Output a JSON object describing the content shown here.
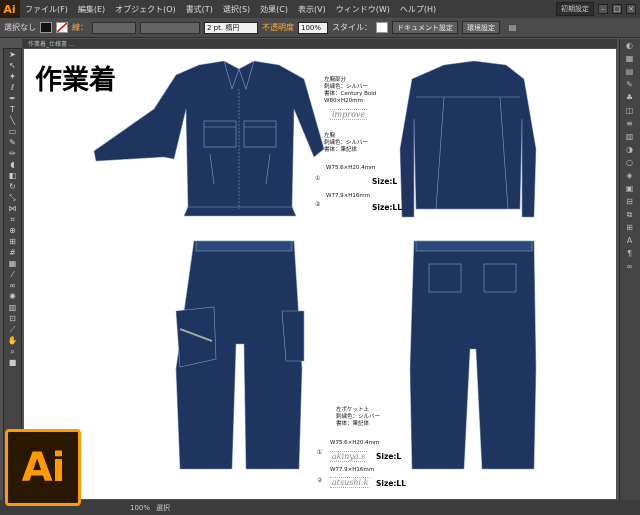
{
  "app": {
    "logo": "Ai"
  },
  "menu": [
    "ファイル(F)",
    "編集(E)",
    "オブジェクト(O)",
    "書式(T)",
    "選択(S)",
    "効果(C)",
    "表示(V)",
    "ウィンドウ(W)",
    "ヘルプ(H)"
  ],
  "workspace": "初期設定",
  "control": {
    "selection": "選択なし",
    "stroke_label": "線：",
    "stroke_weight": "2 pt. 楕円",
    "opacity_label": "不透明度",
    "opacity_value": "100%",
    "style_label": "スタイル：",
    "doc_settings": "ドキュメント設定",
    "env_settings": "環境設定"
  },
  "tab": "作業着_仕様書 ...",
  "status": {
    "zoom": "100%",
    "tool": "選択"
  },
  "artwork": {
    "title": "作業着",
    "jacket_notes": {
      "label1": "左胸部分",
      "line1a": "刺繍色：シルバー",
      "line1b": "書体：Century Bold",
      "line1c": "W80×H20mm",
      "stamp1": "improve",
      "label2": "左胸",
      "line2a": "刺繍色：シルバー",
      "line2b": "書体：筆記体",
      "item1_size": "W75.6×H20.4mm",
      "item1_label": "Size:L",
      "item2_size": "W77.9×H16mm",
      "item2_label": "Size:LL"
    },
    "pants_notes": {
      "label": "左ポケット上",
      "line_a": "刺繍色：シルバー",
      "line_b": "書体：筆記体",
      "item1_size": "W75.6×H20.4mm",
      "item1_label": "Size:L",
      "stamp1": "akinya.s",
      "item2_size": "W77.9×H16mm",
      "item2_label": "Size:LL",
      "stamp2": "atsushi.k"
    },
    "circle1": "①",
    "circle2": "②",
    "garment_color": "#1e3560"
  }
}
